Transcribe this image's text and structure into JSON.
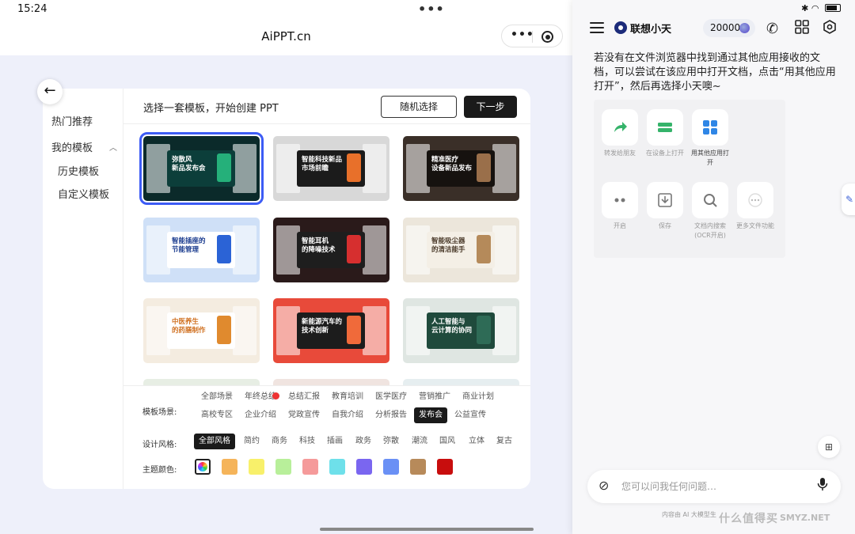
{
  "status": {
    "time": "15:24",
    "top_dots": "•••"
  },
  "app": {
    "title": "AiPPT.cn",
    "capsule_more": "•••"
  },
  "back_icon": "arrow-left-icon",
  "left_nav": {
    "hot": "热门推荐",
    "mine": "我的模板",
    "history": "历史模板",
    "custom": "自定义模板"
  },
  "header": {
    "title": "选择一套模板，开始创建 PPT",
    "random": "随机选择",
    "next": "下一步"
  },
  "templates": [
    {
      "title": "弥散风\n新品发布会",
      "bg": "#0b2a2a",
      "cover": "#0c3e3a",
      "accent": "#25b07a",
      "text": "#ffffff",
      "selected": true
    },
    {
      "title": "智能科技新品\n市场前瞻",
      "bg": "#d8d8d8",
      "cover": "#1b1b1b",
      "accent": "#e8702a",
      "text": "#ffffff",
      "selected": false
    },
    {
      "title": "精准医疗\n设备新品发布",
      "bg": "#3a2f28",
      "cover": "#16120f",
      "accent": "#9a6f4a",
      "text": "#ffffff",
      "selected": false
    },
    {
      "title": "智能插座的\n节能管理",
      "bg": "#cfe0f7",
      "cover": "#ffffff",
      "accent": "#2b63d6",
      "text": "#1b3c8f",
      "selected": false
    },
    {
      "title": "智能耳机\n的降噪技术",
      "bg": "#2a1a1a",
      "cover": "#1e1e1e",
      "accent": "#d62f2f",
      "text": "#ffffff",
      "selected": false
    },
    {
      "title": "智能吸尘器\n的清洁能手",
      "bg": "#ece6db",
      "cover": "#f4efe6",
      "accent": "#b58a5a",
      "text": "#4a3a2a",
      "selected": false
    },
    {
      "title": "中医养生\n的药膳制作",
      "bg": "#f4ece0",
      "cover": "#ffffff",
      "accent": "#e08a2e",
      "text": "#d07020",
      "selected": false
    },
    {
      "title": "新能源汽车的\n技术创新",
      "bg": "#e84a3a",
      "cover": "#1c1c1c",
      "accent": "#f06a3a",
      "text": "#ffffff",
      "selected": false
    },
    {
      "title": "人工智能与\n云计算的协同",
      "bg": "#dfe6e2",
      "cover": "#1f4a3c",
      "accent": "#2e6b56",
      "text": "#ffffff",
      "selected": false
    },
    {
      "title": "",
      "bg": "#e7eee4",
      "cover": "#ffffff",
      "accent": "#7ab57a",
      "text": "#333333",
      "selected": false
    },
    {
      "title": "",
      "bg": "#f0e4e0",
      "cover": "#ffffff",
      "accent": "#d05050",
      "text": "#333333",
      "selected": false
    },
    {
      "title": "",
      "bg": "#e6eef0",
      "cover": "#ffffff",
      "accent": "#5a8aa0",
      "text": "#333333",
      "selected": false
    }
  ],
  "filters": {
    "scene_label": "模板场景:",
    "scenes": [
      "全部场景",
      "年终总结",
      "总结汇报",
      "教育培训",
      "医学医疗",
      "营销推广",
      "商业计划",
      "高校专区",
      "企业介绍",
      "党政宣传",
      "自我介绍",
      "分析报告",
      "发布会",
      "公益宣传"
    ],
    "scene_selected": "发布会",
    "style_label": "设计风格:",
    "styles": [
      "全部风格",
      "简约",
      "商务",
      "科技",
      "插画",
      "政务",
      "弥散",
      "潮流",
      "国风",
      "立体",
      "复古"
    ],
    "style_selected": "全部风格",
    "color_label": "主题颜色:",
    "colors": [
      "rainbow",
      "#f5b45a",
      "#f8f06a",
      "#b8ef9a",
      "#f59a9a",
      "#6ee0ea",
      "#7a66f0",
      "#6a90f5",
      "#b78a5a",
      "#c80d0d"
    ]
  },
  "assistant": {
    "brand": "联想小天",
    "credits": "20000",
    "message": "若没有在文件浏览器中找到通过其他应用接收的文档，可以尝试在该应用中打开文档，点击“用其他应用打开”，然后再选择小天噢~",
    "share_apps": [
      {
        "label": "转发给朋友",
        "icon": "share-arrow-icon"
      },
      {
        "label": "在设备上打开",
        "icon": "device-open-icon"
      },
      {
        "label": "用其他应用打开",
        "icon": "apps-grid-icon"
      },
      {
        "label": "开启",
        "icon": "dots-icon"
      },
      {
        "label": "保存",
        "icon": "download-icon"
      },
      {
        "label": "文档内搜索(OCR开启)",
        "icon": "search-icon"
      },
      {
        "label": "更多文件功能",
        "icon": "more-icon"
      }
    ],
    "input_placeholder": "您可以问我任何问题…",
    "footnote": "内容由 AI 大模型生",
    "watermark": "什么值得买",
    "watermark2": "SMYZ.NET"
  }
}
